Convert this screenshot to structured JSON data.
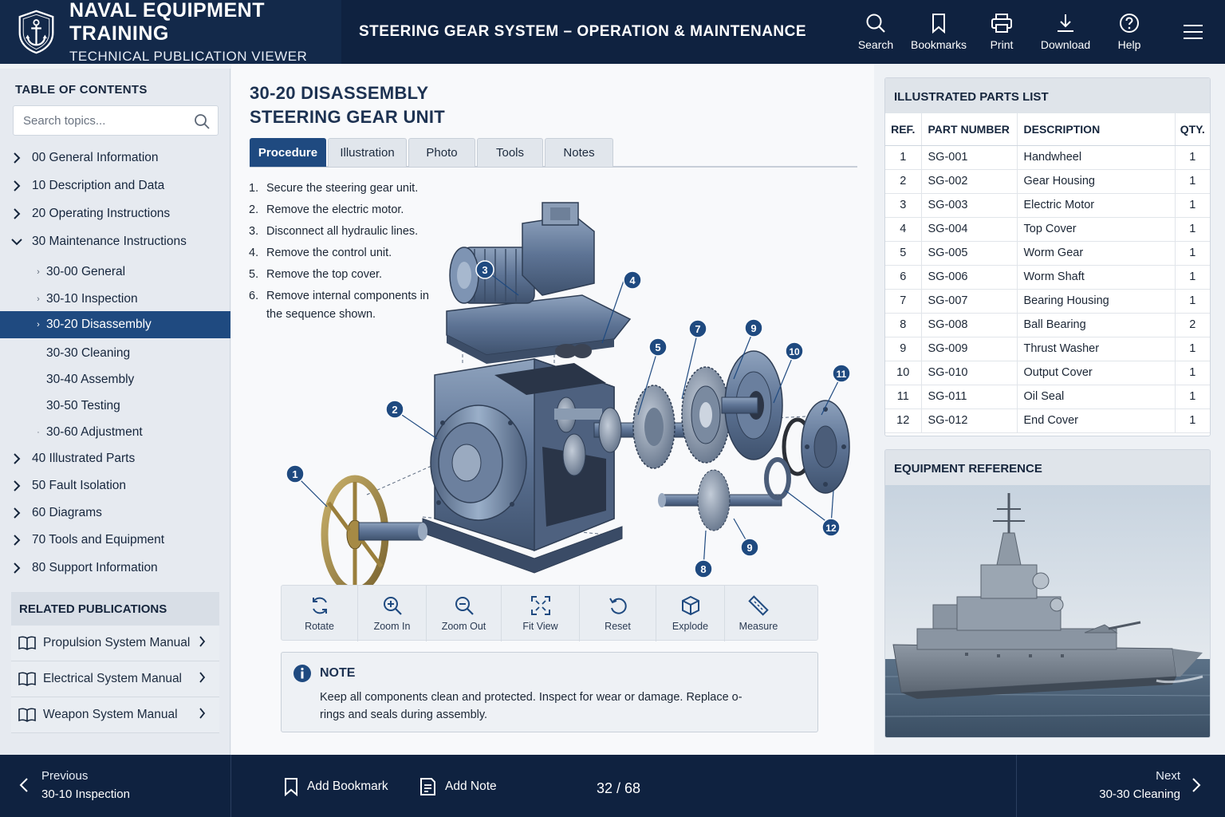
{
  "header": {
    "title": "NAVAL EQUIPMENT TRAINING",
    "subtitle": "TECHNICAL PUBLICATION VIEWER",
    "doc_title": "STEERING GEAR SYSTEM – OPERATION & MAINTENANCE",
    "actions": [
      {
        "label": "Search",
        "icon": "search-icon"
      },
      {
        "label": "Bookmarks",
        "icon": "bookmark-icon"
      },
      {
        "label": "Print",
        "icon": "printer-icon"
      },
      {
        "label": "Download",
        "icon": "download-icon"
      },
      {
        "label": "Help",
        "icon": "help-icon"
      }
    ]
  },
  "sidebar": {
    "heading": "TABLE OF CONTENTS",
    "search_placeholder": "Search topics...",
    "toc": [
      {
        "label": "00 General Information",
        "state": "collapsed"
      },
      {
        "label": "10 Description and Data",
        "state": "collapsed"
      },
      {
        "label": "20 Operating Instructions",
        "state": "collapsed"
      },
      {
        "label": "30 Maintenance Instructions",
        "state": "expanded"
      },
      {
        "label": "30-00  General",
        "level": 2
      },
      {
        "label": "30-10  Inspection",
        "level": 2
      },
      {
        "label": "30-20  Disassembly",
        "level": 2,
        "active": true
      },
      {
        "label": "30-30  Cleaning",
        "level": 2
      },
      {
        "label": "30-40  Assembly",
        "level": 2
      },
      {
        "label": "30-50  Testing",
        "level": 2
      },
      {
        "label": "30-60  Adjustment",
        "level": 2
      },
      {
        "label": "40 Illustrated Parts",
        "state": "collapsed"
      },
      {
        "label": "50 Fault Isolation",
        "state": "collapsed"
      },
      {
        "label": "60 Diagrams",
        "state": "collapsed"
      },
      {
        "label": "70 Tools and Equipment",
        "state": "collapsed"
      },
      {
        "label": "80 Support Information",
        "state": "collapsed"
      }
    ],
    "related_heading": "RELATED PUBLICATIONS",
    "related": [
      "Propulsion System Manual",
      "Electrical System Manual",
      "Weapon System Manual"
    ]
  },
  "main": {
    "title_line1": "30-20 DISASSEMBLY",
    "title_line2": "STEERING GEAR UNIT",
    "tabs": [
      "Procedure",
      "Illustration",
      "Photo",
      "Tools",
      "Notes"
    ],
    "active_tab": "Procedure",
    "steps": [
      {
        "n": "1.",
        "text": "Secure the steering gear unit."
      },
      {
        "n": "2.",
        "text": "Remove the electric motor."
      },
      {
        "n": "3.",
        "text": "Disconnect all hydraulic lines."
      },
      {
        "n": "4.",
        "text": "Remove the control unit."
      },
      {
        "n": "5.",
        "text": "Remove the top cover."
      },
      {
        "n": "6.",
        "text": "Remove internal components in the sequence shown."
      }
    ],
    "callouts": [
      "1",
      "2",
      "3",
      "4",
      "5",
      "7",
      "9",
      "10",
      "11",
      "12",
      "9",
      "8"
    ],
    "toolbar": [
      {
        "label": "Rotate",
        "icon": "rotate-icon"
      },
      {
        "label": "Zoom In",
        "icon": "zoom-in-icon"
      },
      {
        "label": "Zoom Out",
        "icon": "zoom-out-icon"
      },
      {
        "label": "Fit View",
        "icon": "fit-view-icon"
      },
      {
        "label": "Reset",
        "icon": "reset-icon"
      },
      {
        "label": "Explode",
        "icon": "explode-icon"
      },
      {
        "label": "Measure",
        "icon": "measure-icon"
      }
    ],
    "note": {
      "title": "NOTE",
      "text": "Keep all components clean and protected. Inspect for wear or damage. Replace o-rings and seals during assembly."
    }
  },
  "parts_list": {
    "heading": "ILLUSTRATED PARTS LIST",
    "columns": [
      "REF.",
      "PART NUMBER",
      "DESCRIPTION",
      "QTY."
    ],
    "rows": [
      [
        "1",
        "SG-001",
        "Handwheel",
        "1"
      ],
      [
        "2",
        "SG-002",
        "Gear Housing",
        "1"
      ],
      [
        "3",
        "SG-003",
        "Electric Motor",
        "1"
      ],
      [
        "4",
        "SG-004",
        "Top Cover",
        "1"
      ],
      [
        "5",
        "SG-005",
        "Worm Gear",
        "1"
      ],
      [
        "6",
        "SG-006",
        "Worm Shaft",
        "1"
      ],
      [
        "7",
        "SG-007",
        "Bearing Housing",
        "1"
      ],
      [
        "8",
        "SG-008",
        "Ball Bearing",
        "2"
      ],
      [
        "9",
        "SG-009",
        "Thrust Washer",
        "1"
      ],
      [
        "10",
        "SG-010",
        "Output Cover",
        "1"
      ],
      [
        "11",
        "SG-011",
        "Oil Seal",
        "1"
      ],
      [
        "12",
        "SG-012",
        "End Cover",
        "1"
      ]
    ]
  },
  "equipment_reference": {
    "heading": "EQUIPMENT REFERENCE"
  },
  "footer": {
    "previous_label": "Previous",
    "previous_target": "30-10 Inspection",
    "add_bookmark": "Add Bookmark",
    "add_note": "Add Note",
    "page_indicator": "32 / 68",
    "next_label": "Next",
    "next_target": "30-30 Cleaning"
  },
  "colors": {
    "header_bg": "#0f2240",
    "accent": "#1f4a80",
    "callout": "#1f4a80"
  }
}
